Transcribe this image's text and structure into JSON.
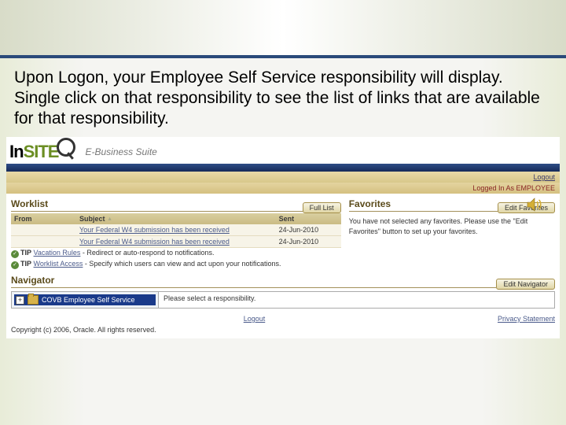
{
  "caption": "Upon Logon, your Employee Self Service responsibility will display. Single click on that responsibility to see the list of links that are available for that responsibility.",
  "logo": {
    "part1": "In",
    "part2": "SITE",
    "tagline": "E-Business Suite"
  },
  "topbar": {
    "logout": "Logout",
    "logged": "Logged In As EMPLOYEE"
  },
  "worklist": {
    "title": "Worklist",
    "full_btn": "Full List",
    "cols": {
      "from": "From",
      "subject": "Subject",
      "sent": "Sent"
    },
    "rows": [
      {
        "subject": "Your Federal W4 submission has been received",
        "sent": "24-Jun-2010"
      },
      {
        "subject": "Your Federal W4 submission has been received",
        "sent": "24-Jun-2010"
      }
    ],
    "tips": [
      {
        "label": "TIP",
        "link": "Vacation Rules",
        "rest": " - Redirect or auto-respond to notifications."
      },
      {
        "label": "TIP",
        "link": "Worklist Access",
        "rest": " - Specify which users can view and act upon your notifications."
      }
    ]
  },
  "favorites": {
    "title": "Favorites",
    "edit_btn": "Edit Favorites",
    "text": "You have not selected any favorites. Please use the \"Edit Favorites\" button to set up your favorites."
  },
  "navigator": {
    "title": "Navigator",
    "edit_btn": "Edit Navigator",
    "item": "COVB Employee Self Service",
    "prompt": "Please select a responsibility."
  },
  "footer": {
    "logout": "Logout",
    "privacy": "Privacy Statement",
    "copyright": "Copyright (c) 2006, Oracle. All rights reserved."
  }
}
